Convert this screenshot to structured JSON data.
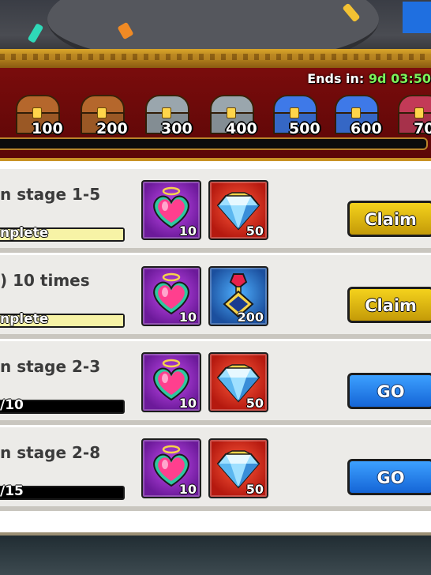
{
  "header": {
    "ends_label": "Ends in:",
    "ends_time": "9d 03:50"
  },
  "chests": [
    {
      "points": "100",
      "icon": "bronze-chest-icon",
      "color": "#b5672c"
    },
    {
      "points": "200",
      "icon": "bronze-chest-icon",
      "color": "#b5672c"
    },
    {
      "points": "300",
      "icon": "silver-chest-icon",
      "color": "#9aa6ad"
    },
    {
      "points": "400",
      "icon": "silver-chest-icon",
      "color": "#9aa6ad"
    },
    {
      "points": "500",
      "icon": "blue-chest-icon",
      "color": "#3e79e8"
    },
    {
      "points": "600",
      "icon": "blue-chest-icon",
      "color": "#3e79e8"
    },
    {
      "points": "70",
      "icon": "ruby-chest-icon",
      "color": "#c33a57"
    }
  ],
  "quests": [
    {
      "title": "n stage 1-5",
      "progress_text": "nplete",
      "progress": 1.0,
      "rewards": [
        {
          "icon": "pink-heart-icon",
          "qty": "10",
          "frame": "purple"
        },
        {
          "icon": "diamond-icon",
          "qty": "50",
          "frame": "red"
        }
      ],
      "button": "Claim",
      "button_type": "claim"
    },
    {
      "title": ") 10 times",
      "progress_text": "nplete",
      "progress": 1.0,
      "rewards": [
        {
          "icon": "pink-heart-icon",
          "qty": "10",
          "frame": "purple"
        },
        {
          "icon": "ruby-potion-icon",
          "qty": "200",
          "frame": "blue"
        }
      ],
      "button": "Claim",
      "button_type": "claim"
    },
    {
      "title": "n stage 2-3",
      "progress_text": "/10",
      "progress": 0,
      "rewards": [
        {
          "icon": "pink-heart-icon",
          "qty": "10",
          "frame": "purple"
        },
        {
          "icon": "diamond-icon",
          "qty": "50",
          "frame": "red"
        }
      ],
      "button": "GO",
      "button_type": "go"
    },
    {
      "title": "n stage 2-8",
      "progress_text": "/15",
      "progress": 0,
      "rewards": [
        {
          "icon": "pink-heart-icon",
          "qty": "10",
          "frame": "purple"
        },
        {
          "icon": "diamond-icon",
          "qty": "50",
          "frame": "red"
        }
      ],
      "button": "GO",
      "button_type": "go"
    }
  ]
}
